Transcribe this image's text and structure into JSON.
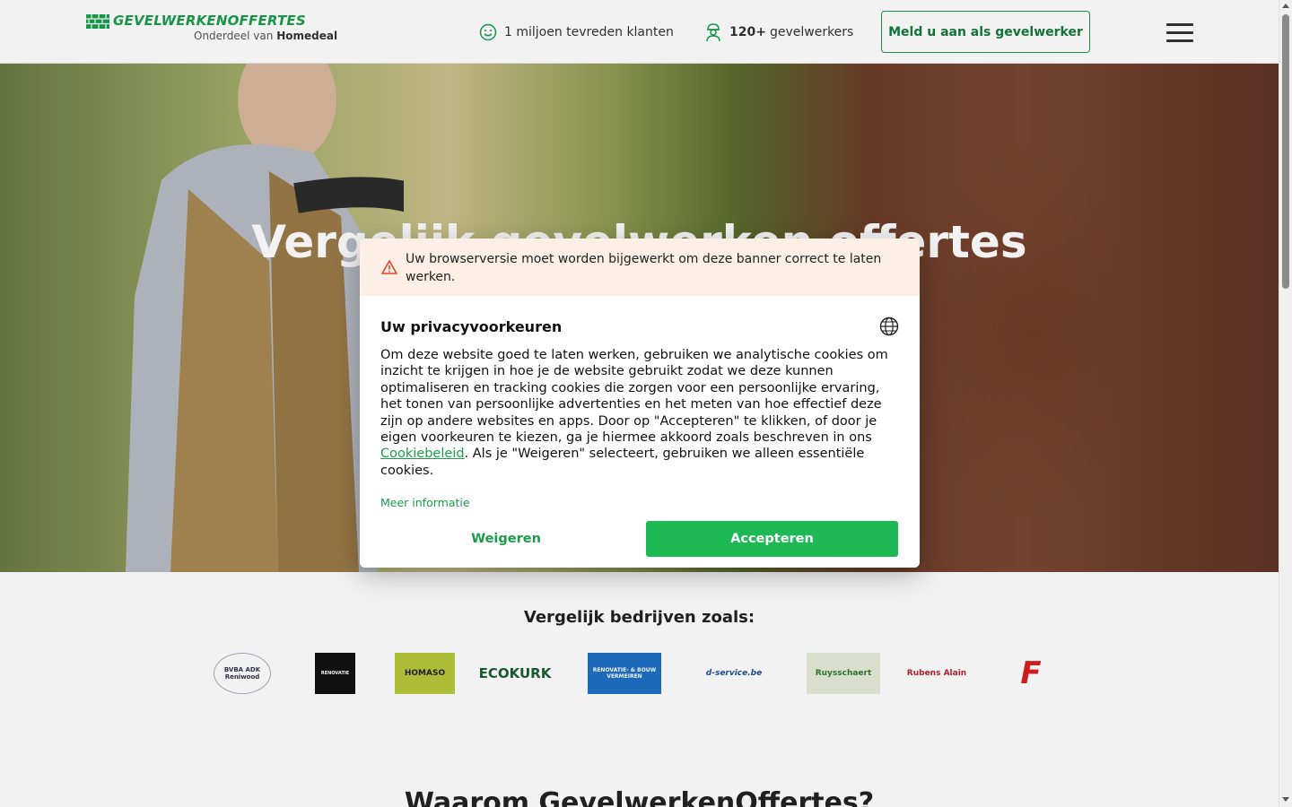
{
  "header": {
    "logo_name": "GEVELWERKENOFFERTES",
    "logo_sub_prefix": "Onderdeel van",
    "logo_sub_brand": "Homedeal",
    "stat_customers": "1 miljoen tevreden klanten",
    "stat_workers_count": "120+",
    "stat_workers_label": "gevelwerkers",
    "cta_label": "Meld u aan als gevelwerker",
    "menu_icon": "hamburger-icon"
  },
  "hero": {
    "title": "Vergelijk gevelwerken offertes"
  },
  "compare": {
    "title": "Vergelijk bedrijven zoals:",
    "brands": [
      "BVBA ADK Reniwood",
      "RENOVATIE",
      "HOMASO",
      "ECOKURK",
      "RENOVATIE- & BOUW VERMEIREN",
      "d-service.be",
      "Ruysschaert",
      "Rubens Alain",
      "F"
    ]
  },
  "why": {
    "title": "Waarom GevelwerkenOffertes?"
  },
  "cookie_modal": {
    "warning": "Uw browserversie moet worden bijgewerkt om deze banner correct te laten werken.",
    "title": "Uw privacyvoorkeuren",
    "body_part1": "Om deze website goed te laten werken, gebruiken we analytische cookies om inzicht te krijgen in hoe je de website gebruikt zodat we deze kunnen optimaliseren en tracking cookies die zorgen voor een persoonlijke ervaring, het tonen van persoonlijke advertenties en het meten van hoe effectief deze zijn op andere websites en apps. Door op \"Accepteren\" te klikken, of door je eigen voorkeuren te kiezen, ga je hiermee akkoord zoals beschreven in ons ",
    "body_link": "Cookiebeleid",
    "body_part2": ". Als je \"Weigeren\" selecteert, gebruiken we alleen essentiële cookies.",
    "more_info": "Meer informatie",
    "decline": "Weigeren",
    "accept": "Accepteren"
  },
  "colors": {
    "brand_green": "#1a9c4a",
    "accept_green": "#1db954",
    "warning_bg": "#fdeee6"
  }
}
